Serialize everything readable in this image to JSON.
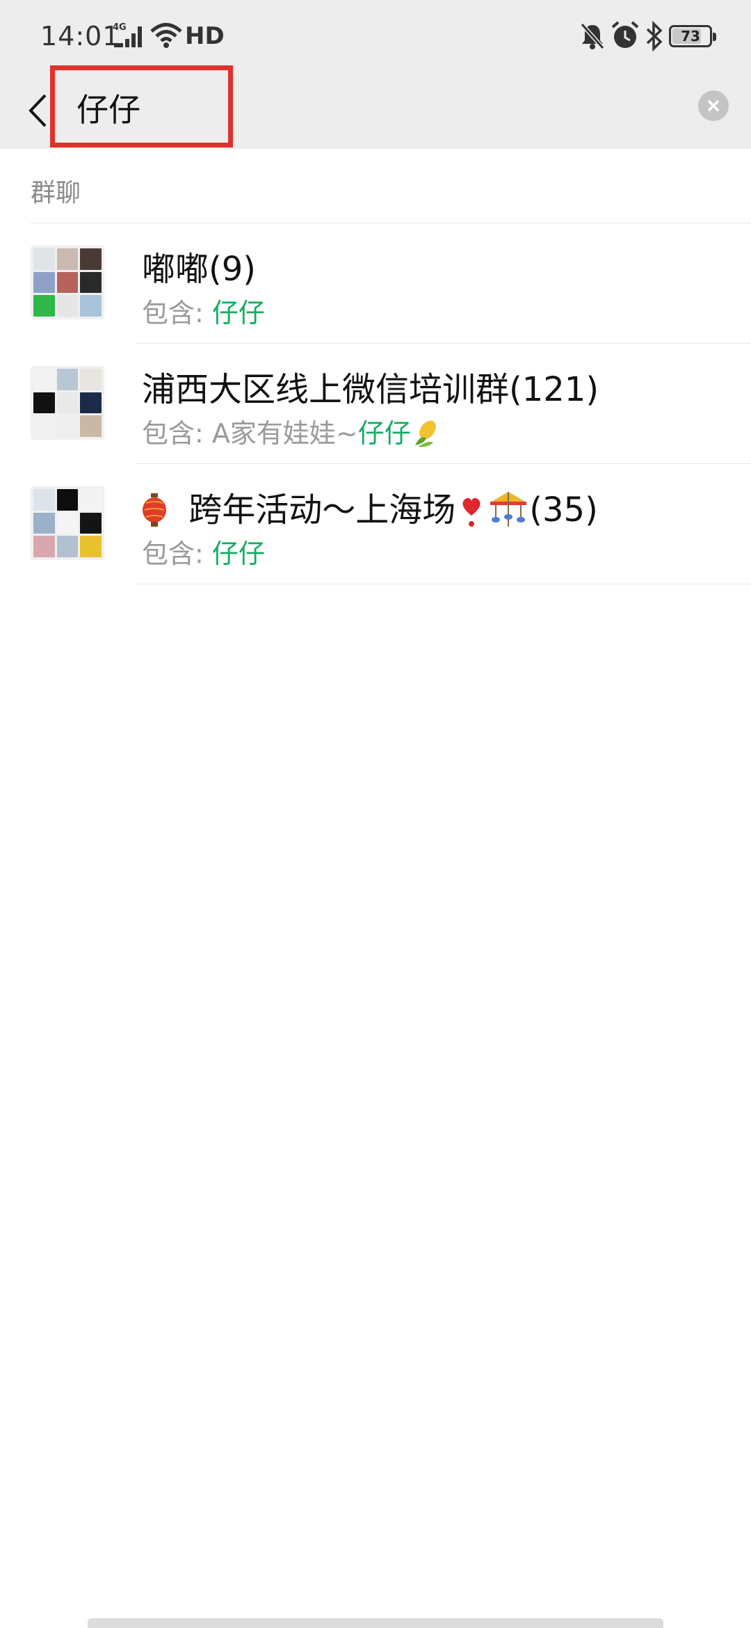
{
  "status_bar": {
    "time": "14:01",
    "network": "4G",
    "hd": "HD",
    "battery": "73"
  },
  "search": {
    "query": "仔仔"
  },
  "section": {
    "title": "群聊"
  },
  "results": [
    {
      "name": "嘟嘟(9)",
      "match_prefix": "包含: ",
      "match_plain": "",
      "match_hit": "仔仔",
      "has_corn": false
    },
    {
      "name": "浦西大区线上微信培训群(121)",
      "match_prefix": "包含: ",
      "match_plain": "A家有娃娃~",
      "match_hit": "仔仔",
      "has_corn": true
    },
    {
      "name_main": " 跨年活动～上海场",
      "name_count": "(35)",
      "match_prefix": "包含: ",
      "match_plain": "",
      "match_hit": "仔仔"
    }
  ],
  "colors": {
    "highlight_green": "#12ad5f",
    "annotation_red": "#e0312b",
    "header_bg": "#ededed"
  },
  "icons": [
    "back-arrow-icon",
    "clear-icon",
    "signal-icon",
    "wifi-icon",
    "mute-bell-icon",
    "alarm-icon",
    "bluetooth-icon",
    "battery-icon",
    "lantern-emoji",
    "heart-emoji",
    "carousel-emoji",
    "corn-emoji"
  ]
}
